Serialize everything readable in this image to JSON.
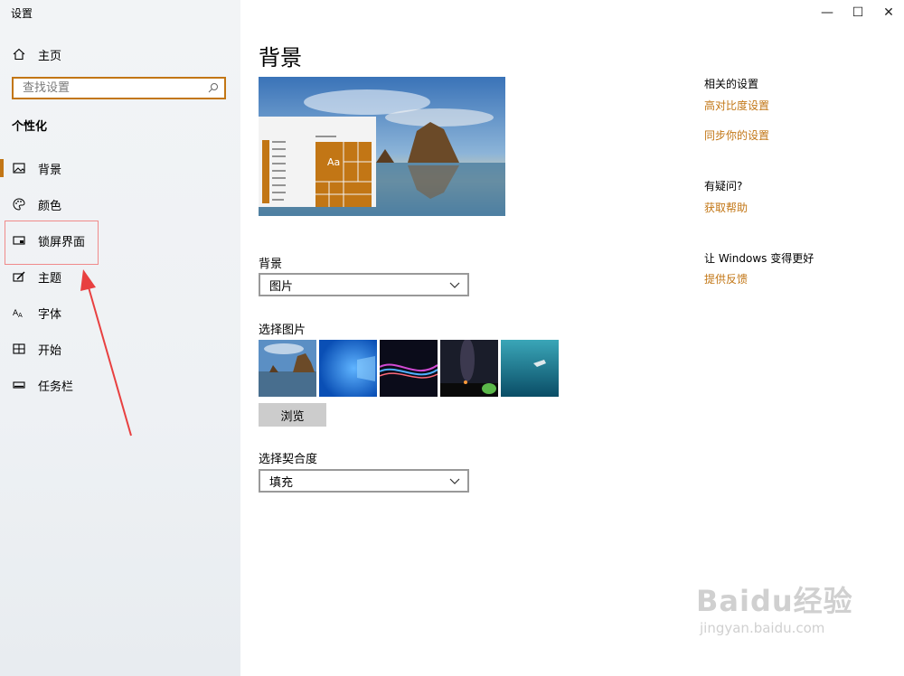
{
  "app_title": "设置",
  "window_controls": {
    "minimize": "—",
    "maximize": "☐",
    "close": "✕"
  },
  "sidebar": {
    "home": "主页",
    "search_placeholder": "查找设置",
    "section_title": "个性化",
    "items": [
      {
        "label": "背景",
        "icon": "image-icon",
        "active": true
      },
      {
        "label": "颜色",
        "icon": "palette-icon",
        "active": false
      },
      {
        "label": "锁屏界面",
        "icon": "lock-screen-icon",
        "active": false
      },
      {
        "label": "主题",
        "icon": "theme-icon",
        "active": false
      },
      {
        "label": "字体",
        "icon": "font-icon",
        "active": false
      },
      {
        "label": "开始",
        "icon": "start-icon",
        "active": false
      },
      {
        "label": "任务栏",
        "icon": "taskbar-icon",
        "active": false
      }
    ]
  },
  "main": {
    "title": "背景",
    "preview_sample_text": "Aa",
    "background_label": "背景",
    "background_value": "图片",
    "choose_picture_label": "选择图片",
    "browse_label": "浏览",
    "fit_label": "选择契合度",
    "fit_value": "填充"
  },
  "related": {
    "related_title": "相关的设置",
    "high_contrast": "高对比度设置",
    "sync": "同步你的设置",
    "question_title": "有疑问?",
    "get_help": "获取帮助",
    "improve_title": "让 Windows 变得更好",
    "feedback": "提供反馈"
  },
  "watermark": {
    "brand": "Baidu经验",
    "url": "jingyan.baidu.com"
  },
  "colors": {
    "accent": "#c27615",
    "annotation": "#e84040"
  }
}
